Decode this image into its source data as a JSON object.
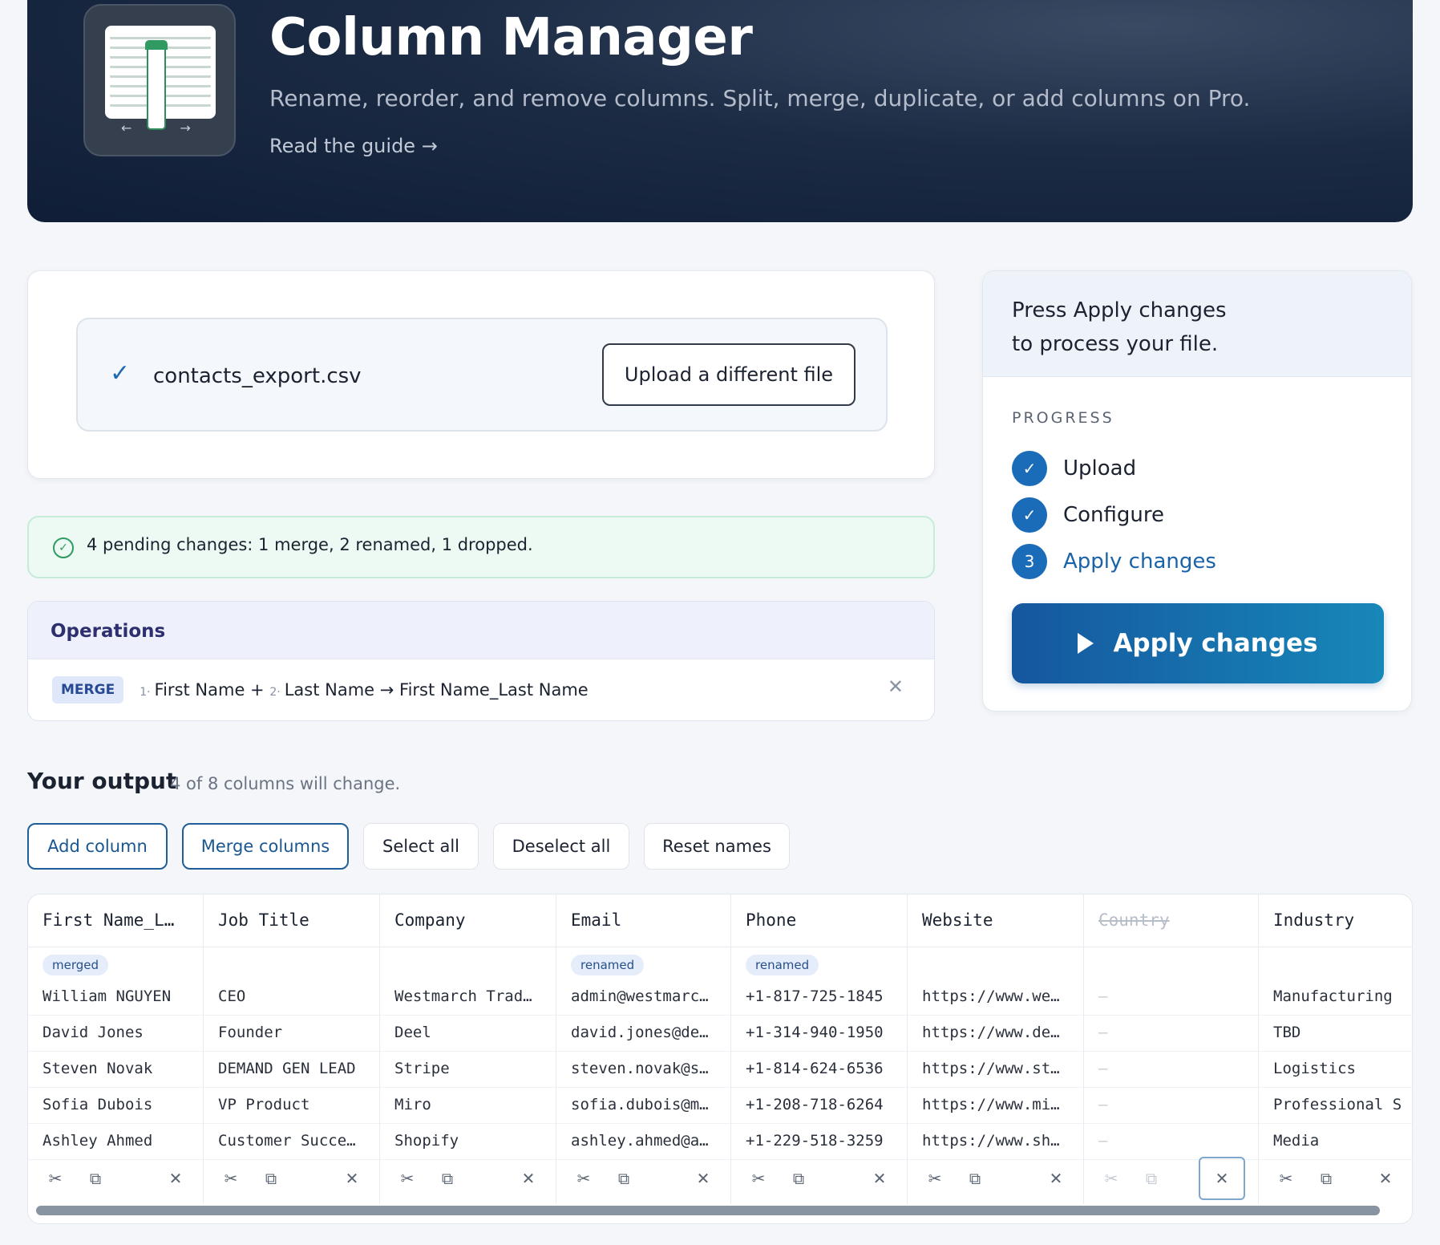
{
  "hero": {
    "title": "Column Manager",
    "subtitle": "Rename, reorder, and remove columns. Split, merge, duplicate, or add columns on Pro.",
    "guide_link": "Read the guide →"
  },
  "upload": {
    "filename": "contacts_export.csv",
    "change_button": "Upload a different file"
  },
  "pending": {
    "text": "4 pending changes: 1 merge, 2 renamed, 1 dropped."
  },
  "operations": {
    "title": "Operations",
    "items": [
      {
        "badge": "MERGE",
        "idx1": "1·",
        "col1": "First Name +",
        "idx2": "2·",
        "col2": "Last Name → First Name_Last Name"
      }
    ]
  },
  "sidebar": {
    "message_line1": "Press Apply changes",
    "message_line2": "to process your file.",
    "progress_label": "PROGRESS",
    "steps": [
      {
        "label": "Upload",
        "state": "done",
        "marker": "✓"
      },
      {
        "label": "Configure",
        "state": "done",
        "marker": "✓"
      },
      {
        "label": "Apply changes",
        "state": "active",
        "marker": "3"
      }
    ],
    "apply_button": "Apply changes"
  },
  "output": {
    "title": "Your output",
    "subtitle": "4 of 8 columns will change.",
    "toolbar": {
      "add_column": "Add column",
      "merge_columns": "Merge columns",
      "select_all": "Select all",
      "deselect_all": "Deselect all",
      "reset_names": "Reset names"
    },
    "columns": [
      {
        "header": "First Name_L…",
        "badge": "merged",
        "dropped": false,
        "cells": [
          "William NGUYEN",
          "David Jones",
          "Steven Novak",
          "Sofia Dubois",
          "Ashley Ahmed"
        ]
      },
      {
        "header": "Job Title",
        "badge": "",
        "dropped": false,
        "cells": [
          "CEO",
          "Founder",
          "DEMAND GEN LEAD",
          "VP Product",
          "Customer Succe…"
        ]
      },
      {
        "header": "Company",
        "badge": "",
        "dropped": false,
        "cells": [
          "Westmarch Trad…",
          "Deel",
          "Stripe",
          "Miro",
          "Shopify"
        ]
      },
      {
        "header": "Email",
        "badge": "renamed",
        "dropped": false,
        "cells": [
          "admin@westmarc…",
          "david.jones@de…",
          "steven.novak@s…",
          "sofia.dubois@m…",
          "ashley.ahmed@a…"
        ]
      },
      {
        "header": "Phone",
        "badge": "renamed",
        "dropped": false,
        "cells": [
          "+1-817-725-1845",
          "+1-314-940-1950",
          "+1-814-624-6536",
          "+1-208-718-6264",
          "+1-229-518-3259"
        ]
      },
      {
        "header": "Website",
        "badge": "",
        "dropped": false,
        "cells": [
          "https://www.we…",
          "https://www.de…",
          "https://www.st…",
          "https://www.mi…",
          "https://www.sh…"
        ]
      },
      {
        "header": "Country",
        "badge": "",
        "dropped": true,
        "cells": [
          "–",
          "–",
          "–",
          "–",
          "–"
        ]
      },
      {
        "header": "Industry",
        "badge": "",
        "dropped": false,
        "cells": [
          "Manufacturing",
          "TBD",
          "Logistics",
          "Professional S",
          "Media"
        ]
      }
    ]
  }
}
